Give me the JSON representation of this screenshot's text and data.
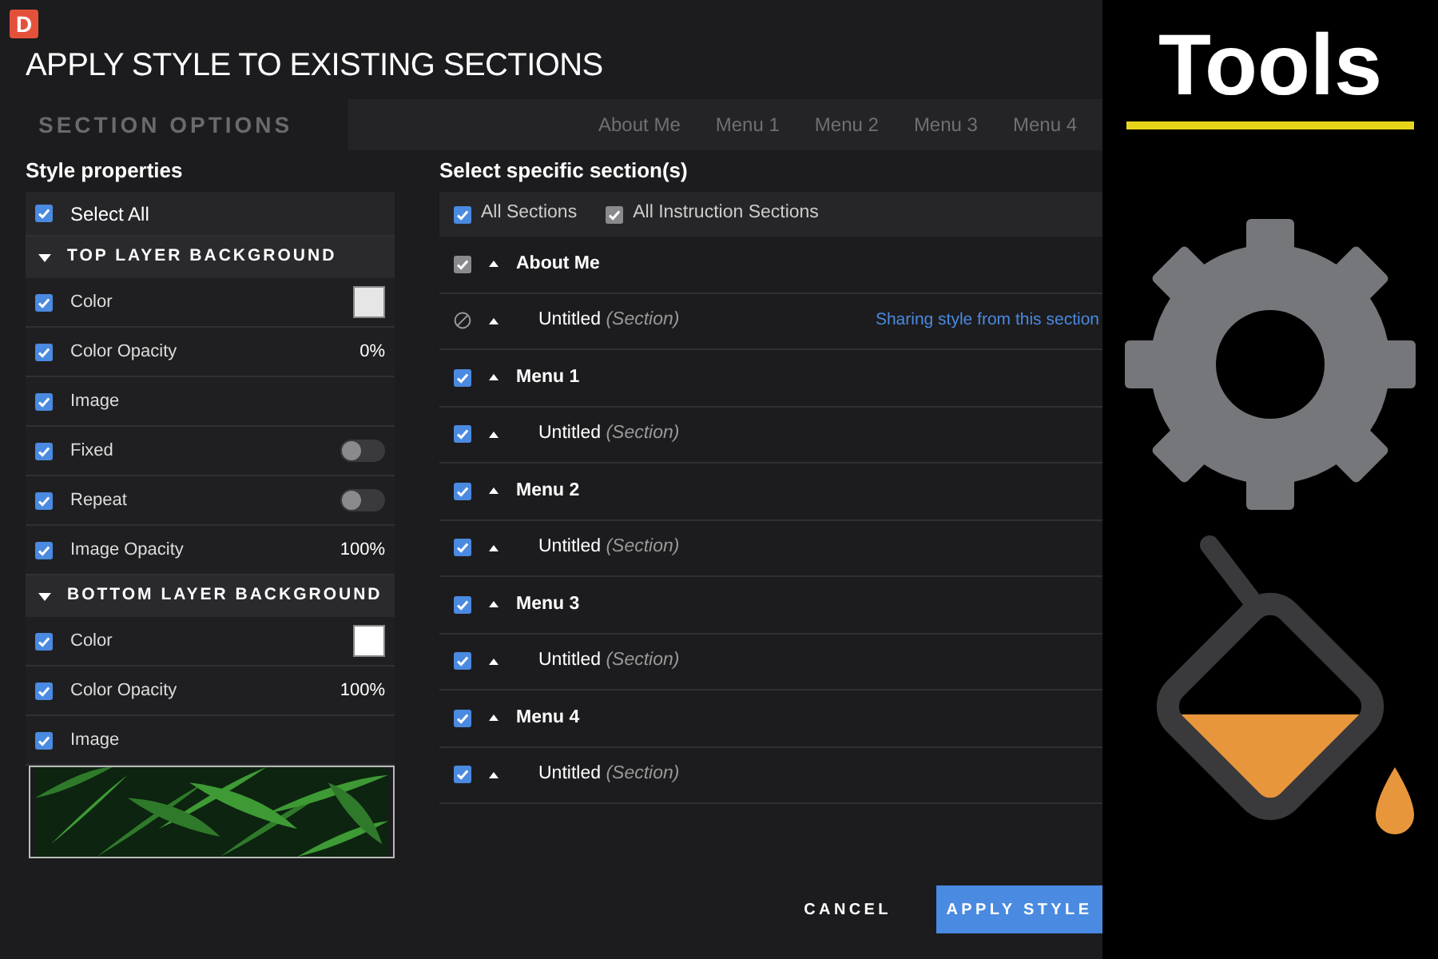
{
  "logo": "D",
  "title": "APPLY STYLE TO EXISTING SECTIONS",
  "background": {
    "section_options": "SECTION OPTIONS",
    "nav": [
      "About Me",
      "Menu 1",
      "Menu 2",
      "Menu 3",
      "Menu 4"
    ]
  },
  "style_properties": {
    "heading": "Style properties",
    "select_all": {
      "label": "Select All",
      "checked": true
    },
    "groups": [
      {
        "title": "TOP LAYER BACKGROUND",
        "expanded": true,
        "items": [
          {
            "kind": "swatch",
            "label": "Color",
            "checked": true,
            "color": "#e6e6e6"
          },
          {
            "kind": "value",
            "label": "Color Opacity",
            "checked": true,
            "value": "0%"
          },
          {
            "kind": "plain",
            "label": "Image",
            "checked": true
          },
          {
            "kind": "toggle",
            "label": "Fixed",
            "checked": true,
            "on": false
          },
          {
            "kind": "toggle",
            "label": "Repeat",
            "checked": true,
            "on": false
          },
          {
            "kind": "value",
            "label": "Image Opacity",
            "checked": true,
            "value": "100%"
          }
        ]
      },
      {
        "title": "BOTTOM LAYER BACKGROUND",
        "expanded": true,
        "items": [
          {
            "kind": "swatch",
            "label": "Color",
            "checked": true,
            "color": "#ffffff"
          },
          {
            "kind": "value",
            "label": "Color Opacity",
            "checked": true,
            "value": "100%"
          },
          {
            "kind": "plain",
            "label": "Image",
            "checked": true
          },
          {
            "kind": "picture"
          }
        ]
      }
    ]
  },
  "sections": {
    "heading": "Select specific section(s)",
    "filters": [
      {
        "label": "All Sections",
        "checked": true,
        "disabled": false
      },
      {
        "label": "All Instruction Sections",
        "checked": true,
        "disabled": true
      }
    ],
    "pages": [
      {
        "name": "About Me",
        "kind": "checkbox",
        "checked": true,
        "disabled": true,
        "children": [
          {
            "name": "Untitled",
            "type": "(Section)",
            "kind": "blocked",
            "note": "Sharing style from this section"
          }
        ]
      },
      {
        "name": "Menu 1",
        "kind": "checkbox",
        "checked": true,
        "disabled": false,
        "children": [
          {
            "name": "Untitled",
            "type": "(Section)",
            "kind": "checkbox",
            "checked": true,
            "disabled": false
          }
        ]
      },
      {
        "name": "Menu 2",
        "kind": "checkbox",
        "checked": true,
        "disabled": false,
        "children": [
          {
            "name": "Untitled",
            "type": "(Section)",
            "kind": "checkbox",
            "checked": true,
            "disabled": false
          }
        ]
      },
      {
        "name": "Menu 3",
        "kind": "checkbox",
        "checked": true,
        "disabled": false,
        "children": [
          {
            "name": "Untitled",
            "type": "(Section)",
            "kind": "checkbox",
            "checked": true,
            "disabled": false
          }
        ]
      },
      {
        "name": "Menu 4",
        "kind": "checkbox",
        "checked": true,
        "disabled": false,
        "children": [
          {
            "name": "Untitled",
            "type": "(Section)",
            "kind": "checkbox",
            "checked": true,
            "disabled": false
          }
        ]
      }
    ]
  },
  "footer": {
    "cancel": "CANCEL",
    "apply": "APPLY STYLE"
  },
  "banner": {
    "title": "Tools"
  }
}
